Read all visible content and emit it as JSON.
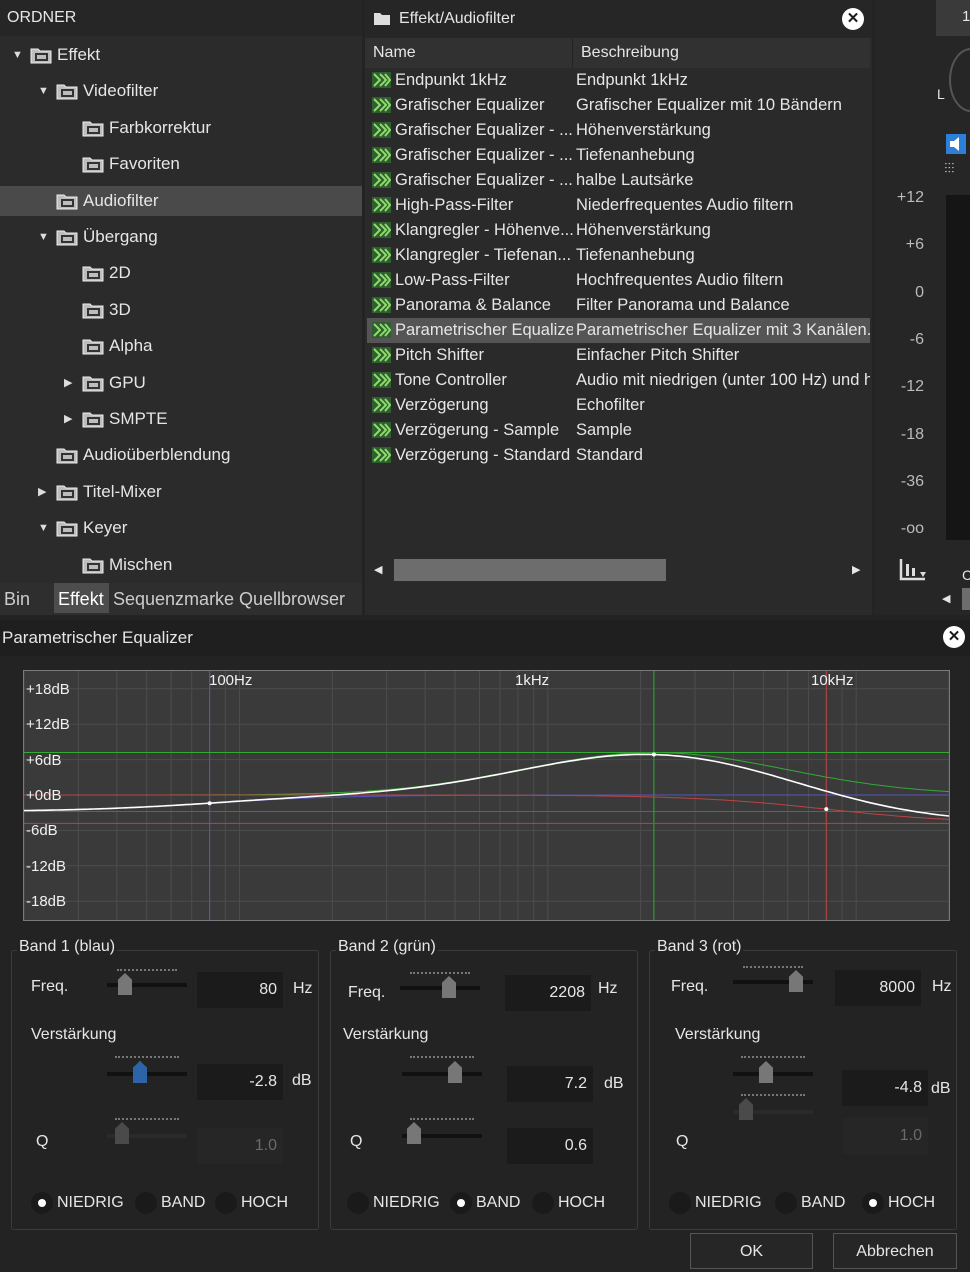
{
  "folders": {
    "header": "ORDNER",
    "items": [
      {
        "label": "Effekt",
        "arrow": "▼"
      },
      {
        "label": "Videofilter",
        "arrow": "▼"
      },
      {
        "label": "Farbkorrektur",
        "arrow": ""
      },
      {
        "label": "Favoriten",
        "arrow": ""
      },
      {
        "label": "Audiofilter",
        "arrow": ""
      },
      {
        "label": "Übergang",
        "arrow": "▼"
      },
      {
        "label": "2D",
        "arrow": ""
      },
      {
        "label": "3D",
        "arrow": ""
      },
      {
        "label": "Alpha",
        "arrow": ""
      },
      {
        "label": "GPU",
        "arrow": "▶"
      },
      {
        "label": "SMPTE",
        "arrow": "▶"
      },
      {
        "label": "Audioüberblendung",
        "arrow": ""
      },
      {
        "label": "Titel-Mixer",
        "arrow": "▶"
      },
      {
        "label": "Keyer",
        "arrow": "▼"
      },
      {
        "label": "Mischen",
        "arrow": ""
      }
    ]
  },
  "tabs": [
    "Bin",
    "Effekt",
    "Sequenzmarke",
    "Quellbrowser"
  ],
  "effect_list": {
    "path": "Effekt/Audiofilter",
    "col_name": "Name",
    "col_desc": "Beschreibung",
    "rows": [
      {
        "name": "Endpunkt 1kHz",
        "desc": "Endpunkt 1kHz"
      },
      {
        "name": "Grafischer Equalizer",
        "desc": "Grafischer Equalizer mit 10 Bändern"
      },
      {
        "name": "Grafischer Equalizer - ...",
        "desc": "Höhenverstärkung"
      },
      {
        "name": "Grafischer Equalizer - ...",
        "desc": "Tiefenanhebung"
      },
      {
        "name": "Grafischer Equalizer - ...",
        "desc": "halbe Lautsärke"
      },
      {
        "name": "High-Pass-Filter",
        "desc": "Niederfrequentes Audio filtern"
      },
      {
        "name": "Klangregler - Höhenve...",
        "desc": "Höhenverstärkung"
      },
      {
        "name": "Klangregler - Tiefenan...",
        "desc": "Tiefenanhebung"
      },
      {
        "name": "Low-Pass-Filter",
        "desc": "Hochfrequentes Audio filtern"
      },
      {
        "name": "Panorama & Balance",
        "desc": "Filter Panorama und Balance"
      },
      {
        "name": "Parametrischer Equalizer",
        "desc": "Parametrischer Equalizer mit 3 Kanälen."
      },
      {
        "name": "Pitch Shifter",
        "desc": "Einfacher Pitch Shifter"
      },
      {
        "name": "Tone Controller",
        "desc": "Audio mit niedrigen (unter 100 Hz) und h"
      },
      {
        "name": "Verzögerung",
        "desc": "Echofilter"
      },
      {
        "name": "Verzögerung - Sample",
        "desc": "Sample"
      },
      {
        "name": "Verzögerung - Standard",
        "desc": "Standard"
      }
    ]
  },
  "meter": {
    "top_label": "1",
    "channel": "L",
    "scale": [
      "+12",
      "+6",
      "0",
      "-6",
      "-12",
      "-18",
      "-36",
      "-oo"
    ],
    "side_label": "C"
  },
  "dialog": {
    "title": "Parametrischer Equalizer",
    "graph": {
      "db_labels": [
        "+18dB",
        "+12dB",
        "+6dB",
        "+0dB",
        "-6dB",
        "-12dB",
        "-18dB"
      ],
      "freq_labels": [
        "100Hz",
        "1kHz",
        "10kHz"
      ],
      "colors": {
        "band1": "#5555bb",
        "band2": "#33aa33",
        "band3": "#bb4444",
        "curve": "#ffffff"
      }
    },
    "bands": [
      {
        "title": "Band 1 (blau)",
        "freq_label": "Freq.",
        "freq": "80",
        "freq_unit": "Hz",
        "gain_label": "Verstärkung",
        "gain": "-2.8",
        "gain_unit": "dB",
        "q_label": "Q",
        "q": "1.0",
        "type": "NIEDRIG"
      },
      {
        "title": "Band 2 (grün)",
        "freq_label": "Freq.",
        "freq": "2208",
        "freq_unit": "Hz",
        "gain_label": "Verstärkung",
        "gain": "7.2",
        "gain_unit": "dB",
        "q_label": "Q",
        "q": "0.6",
        "type": "BAND"
      },
      {
        "title": "Band 3 (rot)",
        "freq_label": "Freq.",
        "freq": "8000",
        "freq_unit": "Hz",
        "gain_label": "Verstärkung",
        "gain": "-4.8",
        "gain_unit": "dB",
        "q_label": "Q",
        "q": "1.0",
        "type": "HOCH"
      }
    ],
    "filter_types": [
      "NIEDRIG",
      "BAND",
      "HOCH"
    ],
    "ok_label": "OK",
    "cancel_label": "Abbrechen"
  }
}
